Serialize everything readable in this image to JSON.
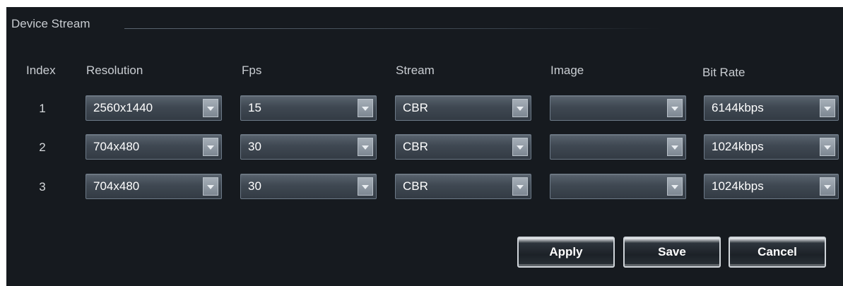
{
  "section": {
    "title": "Device Stream"
  },
  "columns": {
    "index": "Index",
    "resolution": "Resolution",
    "fps": "Fps",
    "stream": "Stream",
    "image": "Image",
    "bitrate": "Bit Rate"
  },
  "rows": [
    {
      "index": "1",
      "resolution": "2560x1440",
      "fps": "15",
      "stream": "CBR",
      "image": "",
      "bitrate": "6144kbps"
    },
    {
      "index": "2",
      "resolution": "704x480",
      "fps": "30",
      "stream": "CBR",
      "image": "",
      "bitrate": "1024kbps"
    },
    {
      "index": "3",
      "resolution": "704x480",
      "fps": "30",
      "stream": "CBR",
      "image": "",
      "bitrate": "1024kbps"
    }
  ],
  "buttons": {
    "apply": "Apply",
    "save": "Save",
    "cancel": "Cancel"
  },
  "icons": {
    "dropdown": "chevron-down-icon"
  },
  "colors": {
    "background": "#161a1f",
    "select": "#3f4852",
    "text": "#ffffff"
  }
}
